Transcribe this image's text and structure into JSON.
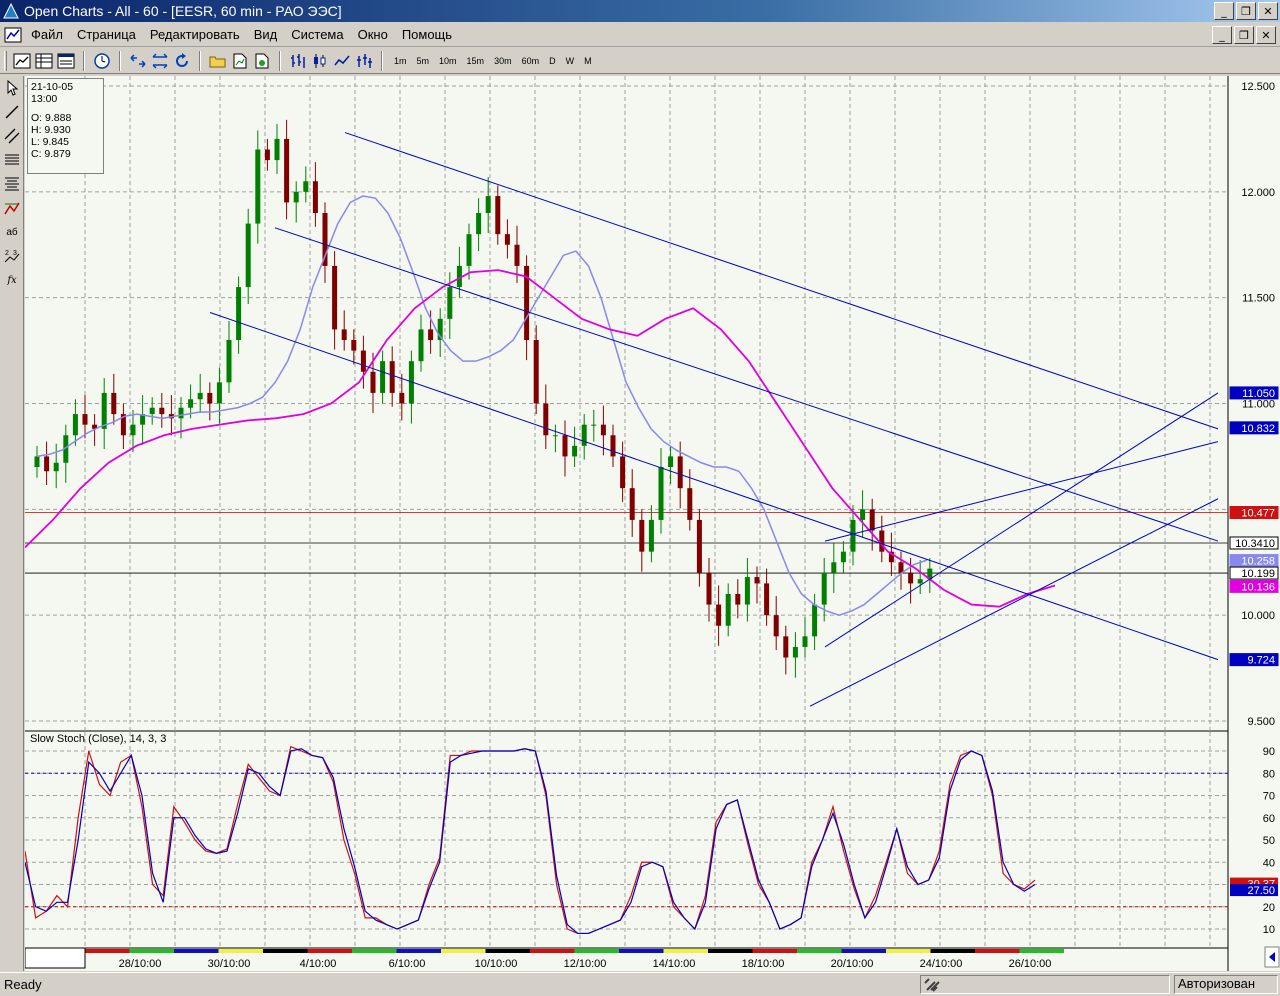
{
  "window": {
    "title": "Open Charts - All - 60 - [EESR, 60 min - РАО ЭЭС]",
    "minimize": "_",
    "restore": "❐",
    "close": "✕"
  },
  "menu": {
    "items": [
      "Файл",
      "Страница",
      "Редактировать",
      "Вид",
      "Система",
      "Окно",
      "Помощь"
    ]
  },
  "toolbar": {
    "timeframes": [
      "1m",
      "5m",
      "10m",
      "15m",
      "30m",
      "60m",
      "D",
      "W",
      "M"
    ]
  },
  "left_tools": {
    "text_tool": "aб",
    "formula_tool": "fx"
  },
  "info_box": {
    "date": "21-10-05",
    "time": "13:00",
    "open": "O: 9.888",
    "high": "H: 9.930",
    "low": "L: 9.845",
    "close": "C: 9.879"
  },
  "chart_data": [
    {
      "type": "candlestick",
      "symbol": "EESR",
      "interval": "60 min",
      "ylim": [
        9.5,
        12.5
      ],
      "yticks": [
        "12.500",
        "12.000",
        "11.500",
        "11.000",
        "10.500",
        "10.000",
        "9.500"
      ],
      "xticks": [
        "28/10:00",
        "30/10:00",
        "4/10:00",
        "6/10:00",
        "10/10:00",
        "12/10:00",
        "14/10:00",
        "18/10:00",
        "20/10:00",
        "24/10:00",
        "26/10:00"
      ],
      "price_markers": [
        {
          "label": "11.050",
          "value": 11.05,
          "color": "#0000c0"
        },
        {
          "label": "10.832",
          "value": 10.885,
          "color": "#0000c0"
        },
        {
          "label": "10.477",
          "value": 10.485,
          "color": "#d01010"
        },
        {
          "label": "10.3410",
          "value": 10.341,
          "color": "#000000"
        },
        {
          "label": "10.258",
          "value": 10.258,
          "color": "#8888ee"
        },
        {
          "label": "10.199",
          "value": 10.199,
          "color": "#000000"
        },
        {
          "label": "10.136",
          "value": 10.136,
          "color": "#e000e0"
        },
        {
          "label": "9.724",
          "value": 9.79,
          "color": "#0000c0"
        }
      ],
      "colors": {
        "up": "#008000",
        "down": "#800000",
        "ma_fast": "#8888ee",
        "ma_slow": "#e000e0",
        "channel": "#0000c0"
      }
    },
    {
      "type": "line",
      "title": "Slow Stoch (Close), 14, 3, 3",
      "ylim": [
        0,
        100
      ],
      "yticks": [
        "90",
        "80",
        "70",
        "60",
        "50",
        "40",
        "30",
        "20",
        "10"
      ],
      "levels": [
        80,
        20
      ],
      "markers": [
        {
          "label": "30.37",
          "value": 30.4,
          "color": "#d01010"
        },
        {
          "label": "27.50",
          "value": 27.5,
          "color": "#0000c0"
        }
      ],
      "series": [
        {
          "values": [
            45,
            15,
            18,
            25,
            20,
            60,
            90,
            75,
            70,
            85,
            88,
            65,
            30,
            25,
            65,
            58,
            50,
            45,
            44,
            46,
            66,
            84,
            78,
            72,
            70,
            92,
            90,
            88,
            87,
            76,
            50,
            35,
            15,
            15,
            12,
            10,
            12,
            14,
            30,
            42,
            88,
            88,
            90,
            90,
            90,
            90,
            90,
            91,
            90,
            70,
            30,
            10,
            8,
            8,
            10,
            12,
            14,
            25,
            40,
            40,
            38,
            20,
            15,
            10,
            25,
            58,
            66,
            68,
            48,
            30,
            22,
            10,
            12,
            15,
            40,
            50,
            65,
            45,
            28,
            15,
            25,
            40,
            55,
            35,
            30,
            32,
            45,
            75,
            88,
            90,
            88,
            70,
            35,
            30,
            28,
            32
          ]
        },
        {
          "values": [
            40,
            20,
            18,
            22,
            22,
            50,
            85,
            80,
            72,
            80,
            88,
            70,
            35,
            22,
            60,
            60,
            52,
            46,
            44,
            45,
            62,
            82,
            80,
            74,
            70,
            90,
            91,
            88,
            87,
            78,
            55,
            38,
            18,
            14,
            12,
            10,
            12,
            14,
            28,
            40,
            85,
            88,
            89,
            90,
            90,
            90,
            90,
            91,
            90,
            72,
            34,
            12,
            8,
            8,
            10,
            12,
            14,
            22,
            38,
            40,
            38,
            22,
            15,
            10,
            22,
            55,
            66,
            68,
            50,
            32,
            22,
            10,
            12,
            15,
            38,
            50,
            62,
            48,
            30,
            15,
            22,
            38,
            55,
            38,
            30,
            32,
            42,
            72,
            86,
            90,
            88,
            72,
            40,
            30,
            27,
            30
          ]
        }
      ]
    }
  ],
  "status": {
    "left": "Ready",
    "right": "Авторизован"
  }
}
